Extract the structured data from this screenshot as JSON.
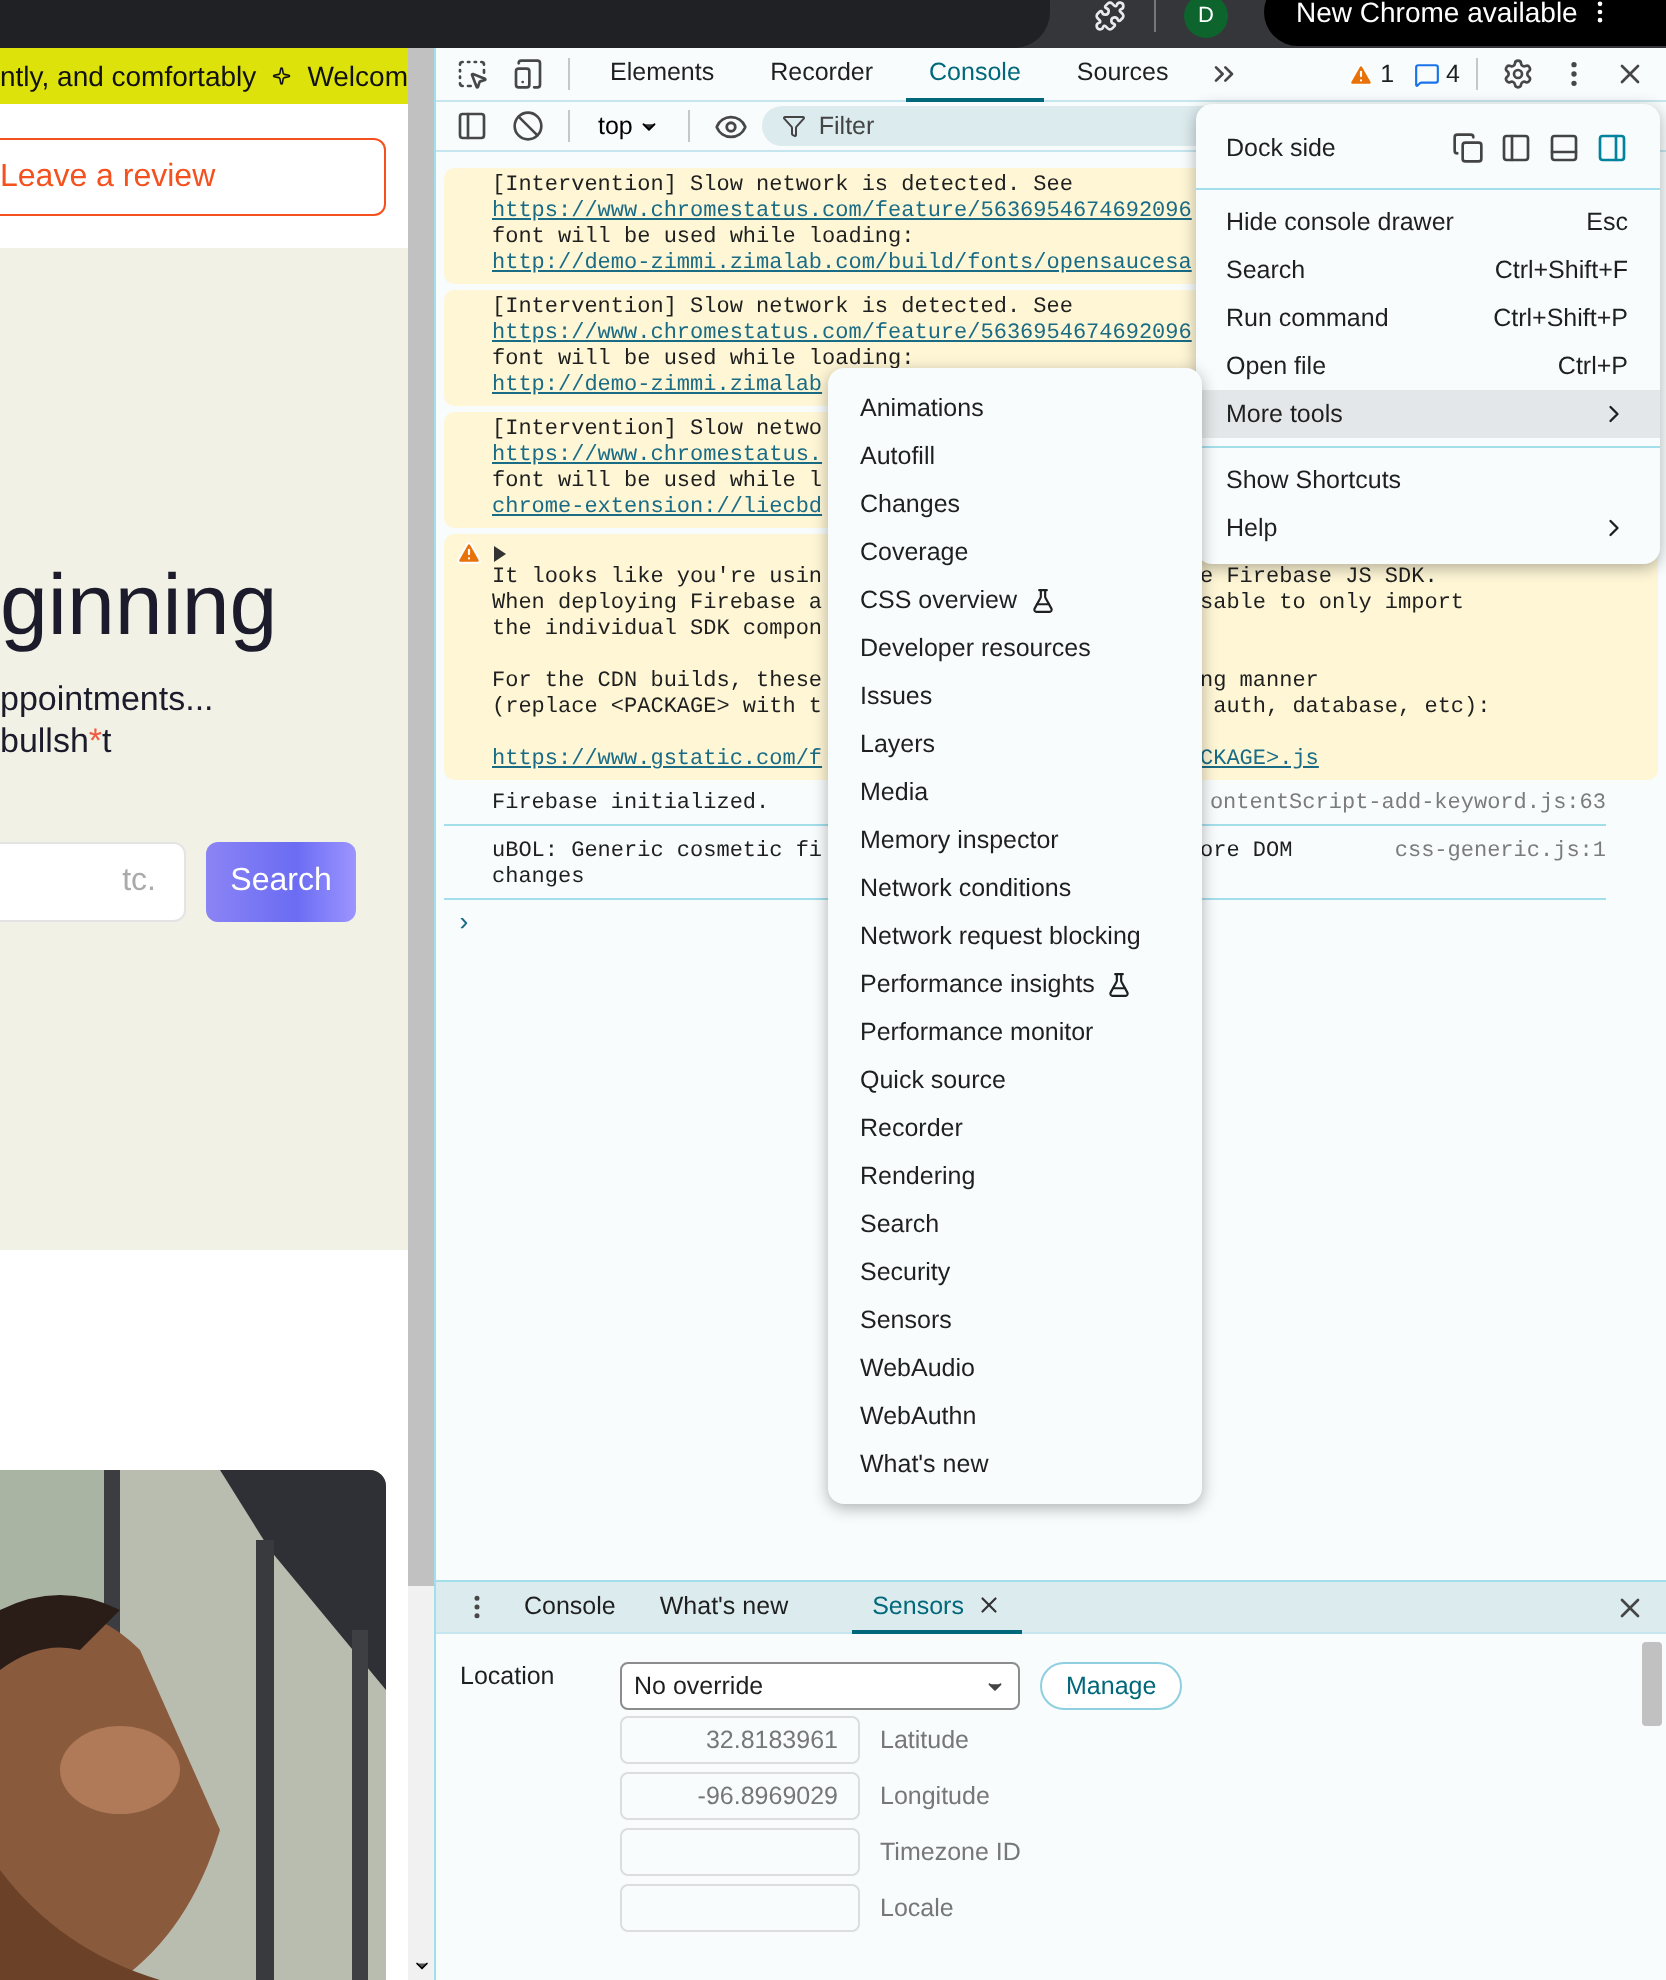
{
  "browser_bar": {
    "avatar": "D",
    "update_pill": "New Chrome available"
  },
  "page": {
    "banner": {
      "text_left": "ntly, and comfortably",
      "text_right": "Welcom"
    },
    "review_button": "Leave a review",
    "hero": {
      "heading": "ginning",
      "line_1": "ppointments...",
      "line_2_before": "bullsh",
      "line_2_mark": "*",
      "line_2_after": "t"
    },
    "search": {
      "placeholder": "tc.",
      "button": "Search"
    }
  },
  "devtools": {
    "tabs": [
      {
        "label": "Elements",
        "selected": false
      },
      {
        "label": "Recorder",
        "selected": false
      },
      {
        "label": "Console",
        "selected": true
      },
      {
        "label": "Sources",
        "selected": false
      }
    ],
    "warnings": "1",
    "messages": "4",
    "console_toolbar": {
      "context": "top",
      "filter_placeholder": "Filter"
    },
    "console": [
      {
        "kind": "intervention",
        "lines": [
          {
            "kind": "text",
            "text": "[Intervention] Slow network is detected. See"
          },
          {
            "kind": "link",
            "text": "https://www.chromestatus.com/feature/5636954674692096"
          },
          {
            "kind": "text",
            "text": "font will be used while loading:"
          },
          {
            "kind": "link",
            "text": "http://demo-zimmi.zimalab.com/build/fonts/opensaucesa"
          }
        ]
      },
      {
        "kind": "intervention",
        "lines": [
          {
            "kind": "text",
            "text": "[Intervention] Slow network is detected. See"
          },
          {
            "kind": "link",
            "text": "https://www.chromestatus.com/feature/5636954674692096"
          },
          {
            "kind": "text",
            "text": "font will be used while loading:"
          },
          {
            "kind": "link",
            "text": "http://demo-zimmi.zimalab"
          }
        ]
      },
      {
        "kind": "intervention",
        "lines": [
          {
            "kind": "text",
            "text": "[Intervention] Slow netwo"
          },
          {
            "kind": "link",
            "text": "https://www.chromestatus."
          },
          {
            "kind": "text",
            "text": "font will be used while l"
          },
          {
            "kind": "link",
            "text": "chrome-extension://liecbd"
          }
        ]
      },
      {
        "kind": "warning",
        "lines": [
          {
            "kind": "text",
            "text": "It looks like you're usin",
            "tail": "e Firebase JS SDK."
          },
          {
            "kind": "text",
            "text": "When deploying Firebase a",
            "tail": "sable to only import"
          },
          {
            "kind": "text",
            "text": "the individual SDK compon"
          },
          {
            "kind": "blank"
          },
          {
            "kind": "text",
            "text": "For the CDN builds, these",
            "tail": "ng manner"
          },
          {
            "kind": "text",
            "text": "(replace <PACKAGE> with t",
            "tail": " auth, database, etc):"
          },
          {
            "kind": "blank"
          },
          {
            "kind": "link",
            "text": "https://www.gstatic.com/f",
            "tail": "CKAGE>.js"
          }
        ]
      },
      {
        "kind": "log",
        "source": "ontentScript-add-keyword.js:63",
        "lines": [
          {
            "kind": "text",
            "text": "Firebase initialized."
          }
        ]
      },
      {
        "kind": "log",
        "source": "css-generic.js:1",
        "lines": [
          {
            "kind": "text",
            "text": "uBOL: Generic cosmetic fi",
            "tail": "ore DOM"
          },
          {
            "kind": "text",
            "text": "changes"
          }
        ]
      }
    ],
    "prompt": "›",
    "main_menu": {
      "dock_label": "Dock side",
      "dock_options": [
        {
          "kind": "undock",
          "selected": false
        },
        {
          "kind": "left",
          "selected": false
        },
        {
          "kind": "bottom",
          "selected": false
        },
        {
          "kind": "right",
          "selected": true
        }
      ],
      "items": [
        {
          "kind": "item",
          "label": "Hide console drawer",
          "shortcut": "Esc",
          "selected": false
        },
        {
          "kind": "item",
          "label": "Search",
          "shortcut": "Ctrl+Shift+F",
          "selected": false
        },
        {
          "kind": "item",
          "label": "Run command",
          "shortcut": "Ctrl+Shift+P",
          "selected": false
        },
        {
          "kind": "item",
          "label": "Open file",
          "shortcut": "Ctrl+P",
          "selected": false
        },
        {
          "kind": "submenu",
          "label": "More tools",
          "selected": true
        },
        {
          "kind": "divider"
        },
        {
          "kind": "item",
          "label": "Show Shortcuts",
          "selected": false
        },
        {
          "kind": "submenu",
          "label": "Help",
          "selected": false
        }
      ]
    },
    "more_tools": [
      {
        "label": "Animations",
        "experimental": false
      },
      {
        "label": "Autofill",
        "experimental": false
      },
      {
        "label": "Changes",
        "experimental": false
      },
      {
        "label": "Coverage",
        "experimental": false
      },
      {
        "label": "CSS overview",
        "experimental": true
      },
      {
        "label": "Developer resources",
        "experimental": false
      },
      {
        "label": "Issues",
        "experimental": false
      },
      {
        "label": "Layers",
        "experimental": false
      },
      {
        "label": "Media",
        "experimental": false
      },
      {
        "label": "Memory inspector",
        "experimental": false
      },
      {
        "label": "Network conditions",
        "experimental": false
      },
      {
        "label": "Network request blocking",
        "experimental": false
      },
      {
        "label": "Performance insights",
        "experimental": true
      },
      {
        "label": "Performance monitor",
        "experimental": false
      },
      {
        "label": "Quick source",
        "experimental": false
      },
      {
        "label": "Recorder",
        "experimental": false
      },
      {
        "label": "Rendering",
        "experimental": false
      },
      {
        "label": "Search",
        "experimental": false
      },
      {
        "label": "Security",
        "experimental": false
      },
      {
        "label": "Sensors",
        "experimental": false
      },
      {
        "label": "WebAudio",
        "experimental": false
      },
      {
        "label": "WebAuthn",
        "experimental": false
      },
      {
        "label": "What's new",
        "experimental": false
      }
    ],
    "drawer": {
      "tabs": [
        {
          "label": "Console",
          "selected": false,
          "closable": false
        },
        {
          "label": "What's new",
          "selected": false,
          "closable": false
        },
        {
          "label": "Sensors",
          "selected": true,
          "closable": true
        }
      ],
      "sensors": {
        "location_label": "Location",
        "location_value": "No override",
        "manage_button": "Manage",
        "fields": [
          {
            "label": "Latitude",
            "value": "32.8183961"
          },
          {
            "label": "Longitude",
            "value": "-96.8969029"
          },
          {
            "label": "Timezone ID"
          },
          {
            "label": "Locale"
          }
        ]
      }
    }
  }
}
